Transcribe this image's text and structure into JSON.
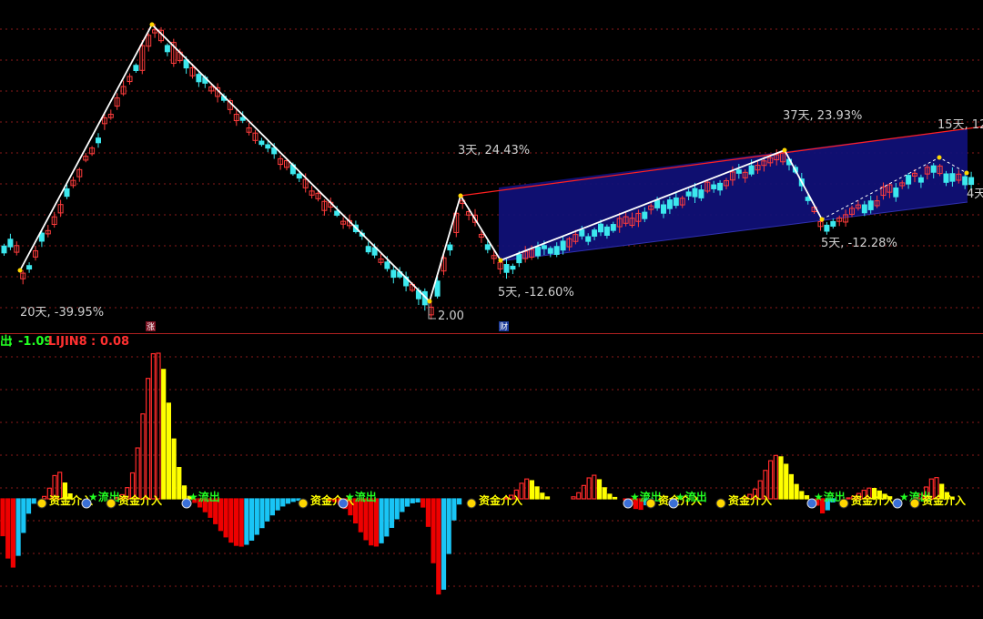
{
  "chart_data": [
    {
      "type": "candlestick",
      "price_line_label": "2.00",
      "zigzag_labels": [
        {
          "text": "20天, -39.95%"
        },
        {
          "text": "3天, 24.43%"
        },
        {
          "text": "5天, -12.60%"
        },
        {
          "text": "37天, 23.93%"
        },
        {
          "text": "5天, -12.28%"
        },
        {
          "text": "15天, 12"
        },
        {
          "text": "4天"
        }
      ],
      "event_markers": [
        "涨",
        "财"
      ],
      "colors": {
        "up": "#ff3c3c",
        "down": "#3ce8ee",
        "zigzag": "#ffffff",
        "channel_fill": "#10107a",
        "channel_edge": "#ff2020",
        "pivot": "#ffd700",
        "grid": "#8a1a1a"
      }
    },
    {
      "type": "bar",
      "indicator_name_prefix": "出",
      "indicator_value_1": "-1.09",
      "indicator_name_2": "LIJIN8",
      "indicator_value_2": "0.08",
      "inflow_label": "资金介入",
      "outflow_label": "★流出",
      "colors": {
        "pos_rising": "#ff2a2a",
        "pos_falling": "#ffff00",
        "neg_falling": "#ee0000",
        "neg_rising": "#19c5f5",
        "inflow_text": "#ffff00",
        "outflow_text": "#22ff22"
      }
    }
  ]
}
